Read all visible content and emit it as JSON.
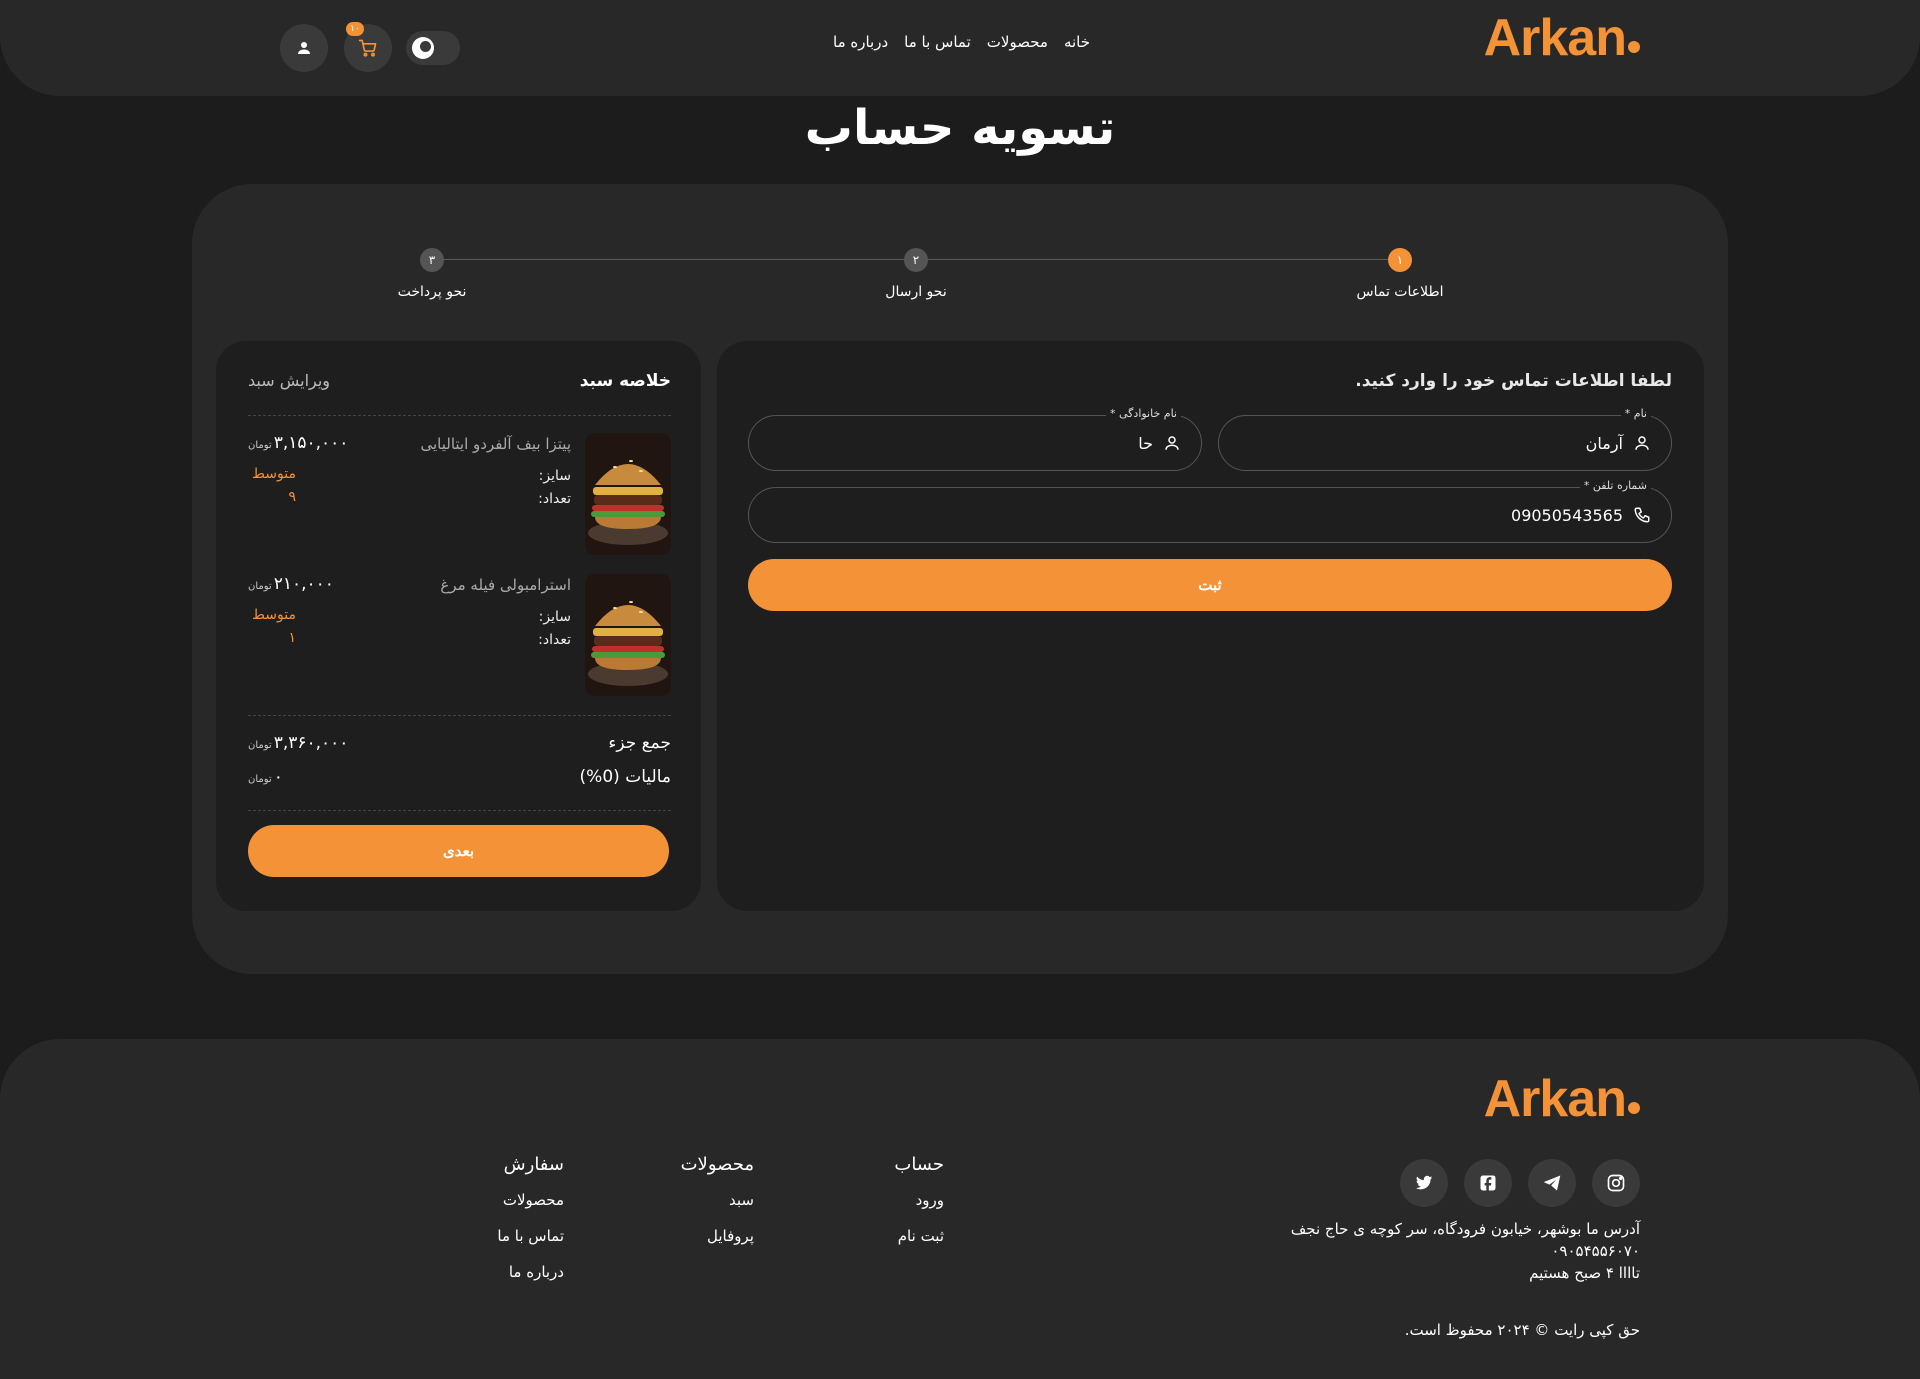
{
  "brand": {
    "logo_text": "Arkan",
    "accent_color": "#f39237"
  },
  "header": {
    "nav": [
      "خانه",
      "محصولات",
      "تماس با ما",
      "درباره ما"
    ],
    "cart_count": "۱۰",
    "icons": {
      "user": "user-icon",
      "cart": "cart-icon",
      "theme": "moon-icon"
    }
  },
  "page_title": "تسویه حساب",
  "steps": [
    {
      "num": "۱",
      "label": "اطلاعات تماس",
      "active": true
    },
    {
      "num": "۲",
      "label": "نحو ارسال",
      "active": false
    },
    {
      "num": "۳",
      "label": "نحو پرداخت",
      "active": false
    }
  ],
  "form": {
    "heading": "لطفا اطلاعات تماس خود را وارد کنید.",
    "first_name": {
      "label": "نام *",
      "value": "آرمان"
    },
    "last_name": {
      "label": "نام خانوادگی *",
      "value": "حا"
    },
    "phone": {
      "label": "شماره تلفن *",
      "value": "09050543565"
    },
    "submit_label": "ثبت"
  },
  "summary": {
    "title": "خلاصه سبد",
    "edit_label": "ویرایش سبد",
    "items": [
      {
        "name": "پیتزا بیف آلفردو ایتالیایی",
        "price": "۳,۱۵۰,۰۰۰",
        "currency": "تومان",
        "size_label": "سایز:",
        "size": "متوسط",
        "qty_label": "تعداد:",
        "qty": "۹"
      },
      {
        "name": "استرامبولی فیله مرغ",
        "price": "۲۱۰,۰۰۰",
        "currency": "تومان",
        "size_label": "سایز:",
        "size": "متوسط",
        "qty_label": "تعداد:",
        "qty": "۱"
      }
    ],
    "subtotal_label": "جمع جزء",
    "subtotal": "۳,۳۶۰,۰۰۰",
    "tax_label": "مالیات (0%)",
    "tax": "۰",
    "currency": "تومان",
    "next_label": "بعدی"
  },
  "footer": {
    "address": "آدرس ما بوشهر، خیابون فرودگاه، سر کوچه ی حاج نجف",
    "phone": "۰۹۰۵۴۵۵۶۰۷۰",
    "hours": "تاااا ۴ صبح هستیم",
    "copyright": "حق کپی رایت © ۲۰۲۴ محفوظ است.",
    "social": [
      "instagram-icon",
      "telegram-icon",
      "facebook-icon",
      "twitter-icon"
    ],
    "columns": [
      {
        "title": "حساب",
        "links": [
          "ورود",
          "ثبت نام"
        ]
      },
      {
        "title": "محصولات",
        "links": [
          "سبد",
          "پروفایل"
        ]
      },
      {
        "title": "سفارش",
        "links": [
          "محصولات",
          "تماس با ما",
          "درباره ما"
        ]
      }
    ]
  }
}
